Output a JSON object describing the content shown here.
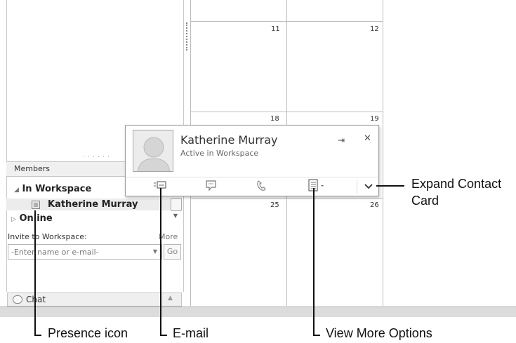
{
  "sidebar": {
    "members_title": "Members",
    "groups": [
      {
        "label": "In Workspace",
        "arrow": "◢"
      },
      {
        "label": "Online",
        "arrow": "▷"
      }
    ],
    "member": {
      "name": "Katherine Murray"
    },
    "invite_label": "Invite to Workspace:",
    "more_link": "More",
    "invite_placeholder": "-Enter name or e-mail-",
    "go_button": "Go",
    "chat_label": "Chat"
  },
  "calendar": {
    "days": [
      "11",
      "12",
      "18",
      "19",
      "25",
      "26"
    ]
  },
  "contact_card": {
    "name": "Katherine Murray",
    "status": "Active in Workspace"
  },
  "callouts": {
    "expand": "Expand Contact\nCard",
    "presence": "Presence icon",
    "email": "E-mail",
    "view_more": "View More Options"
  }
}
